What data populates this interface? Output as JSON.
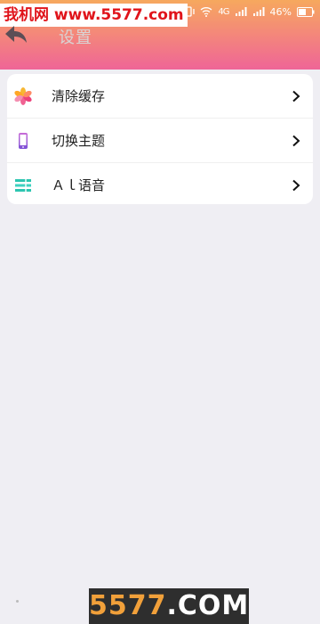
{
  "watermark": {
    "top_text": "我机网 www.5577.com",
    "bottom_text_main": "5577",
    "bottom_text_suffix": ".COM"
  },
  "status_bar": {
    "network": "4G",
    "battery": "46%"
  },
  "header": {
    "title": "设置"
  },
  "settings": {
    "items": [
      {
        "label": "清除缓存",
        "icon": "asterisk-flower-icon"
      },
      {
        "label": "切换主题",
        "icon": "phone-icon"
      },
      {
        "label": "Ａｌ语音",
        "icon": "text-lines-icon"
      }
    ]
  }
}
